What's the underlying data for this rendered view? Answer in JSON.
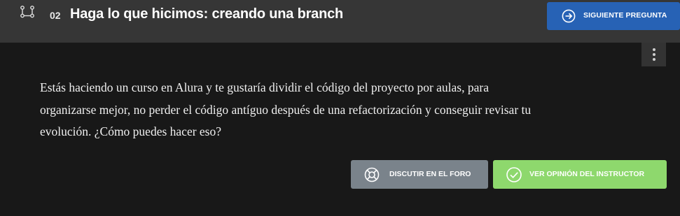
{
  "header": {
    "icon": "branch-icon",
    "number": "02",
    "title": "Haga lo que hicimos: creando una branch",
    "next_button": {
      "icon": "arrow-right-circle-icon",
      "label": "SIGUIENTE PREGUNTA",
      "color": "#2762b5"
    }
  },
  "menu": {
    "icon": "more-vertical-icon"
  },
  "question": {
    "lines": [
      "Estás haciendo un curso en Alura y te gustaría dividir el código del proyecto por aulas, para",
      "organizarse mejor, no perder el código antíguo después de una refactorización y conseguir revisar tu",
      "evolución. ¿Cómo puedes hacer eso?"
    ]
  },
  "actions": {
    "forum": {
      "icon": "lifebuoy-icon",
      "label": "DISCUTIR EN EL FORO",
      "color": "#7a838b"
    },
    "instructor": {
      "icon": "check-circle-icon",
      "label": "VER OPINIÓN DEL INSTRUCTOR",
      "color": "#8ed86d"
    }
  }
}
